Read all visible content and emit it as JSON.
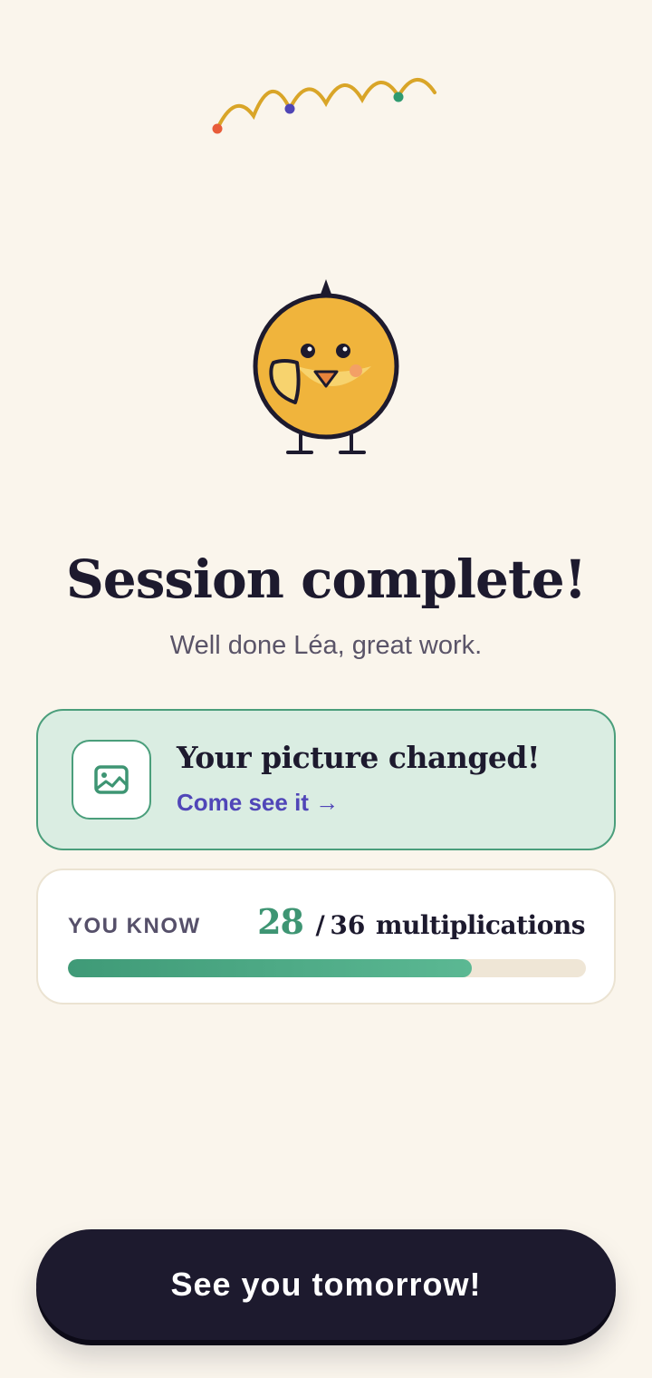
{
  "decor": {
    "squiggle_color": "#d9a528",
    "dot_colors": [
      "#e85c3a",
      "#4f45b5",
      "#2f9a70"
    ]
  },
  "mascot": {
    "icon": "chick-mascot-icon",
    "body_color": "#f0b43c",
    "outline_color": "#1d1a2e"
  },
  "title": "Session complete!",
  "subtitle": "Well done Léa, great work.",
  "picture_card": {
    "icon": "image-icon",
    "title": "Your picture changed!",
    "link_label": "Come see it →",
    "accent_color": "#4a9e7b",
    "background": "#daede2"
  },
  "progress": {
    "label": "YOU KNOW",
    "known": "28",
    "separator": "/",
    "total": "36",
    "unit": "multiplications",
    "fraction": 0.78,
    "fill_color": "#4aa67f"
  },
  "cta": {
    "label": "See you tomorrow!"
  }
}
